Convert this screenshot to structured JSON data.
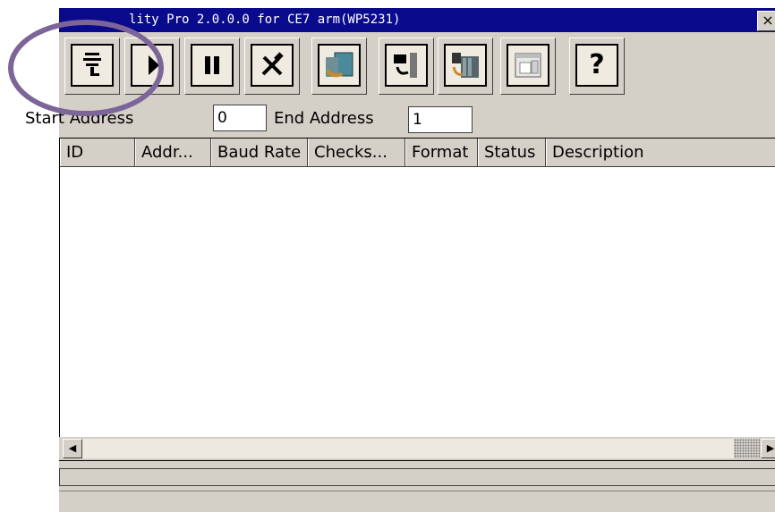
{
  "window": {
    "title": "lity Pro 2.0.0.0 for CE7 arm(WP5231)",
    "close_label": "×"
  },
  "toolbar": {
    "buttons": [
      {
        "icon": "search-module-icon"
      },
      {
        "icon": "play-icon"
      },
      {
        "icon": "pause-icon"
      },
      {
        "icon": "tools-icon"
      },
      {
        "icon": "module-config-icon"
      },
      {
        "icon": "load-file-icon"
      },
      {
        "icon": "module-rack-icon"
      },
      {
        "icon": "window-settings-icon"
      },
      {
        "icon": "help-icon",
        "glyph": "?"
      }
    ]
  },
  "address": {
    "start_label": "Start Address",
    "start_value": "0",
    "end_label": "End Address",
    "end_value": "1"
  },
  "listview": {
    "columns": [
      "ID",
      "Addr...",
      "Baud Rate",
      "Checks...",
      "Format",
      "Status",
      "Description"
    ]
  },
  "scrollbar": {
    "left_arrow": "◀",
    "right_arrow": "▶"
  },
  "colors": {
    "titlebar": "#0a0a8c",
    "highlight_ring": "#7c6598",
    "face": "#d4d0c8"
  }
}
